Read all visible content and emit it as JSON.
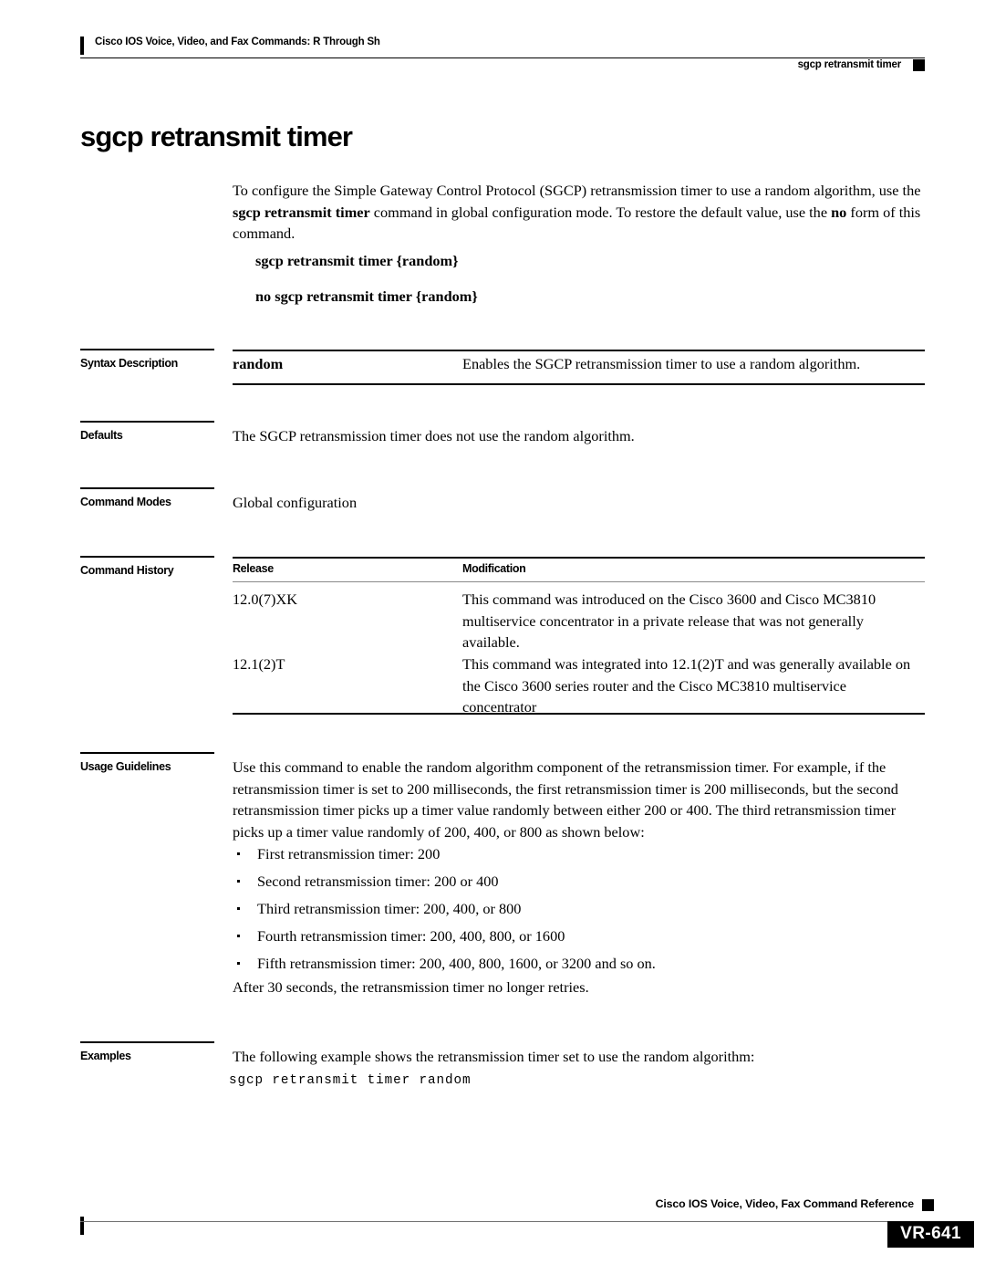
{
  "header": {
    "book_title": "Cisco IOS Voice, Video, and Fax Commands: R Through Sh",
    "running_head": "sgcp retransmit timer"
  },
  "command": {
    "title": "sgcp retransmit timer",
    "intro": {
      "part1": "To configure the Simple Gateway Control Protocol (SGCP) retransmission timer to use a random algorithm, use the ",
      "bold1": "sgcp retransmit timer",
      "part2": " command in global configuration mode. To restore the default value, use the ",
      "bold2": "no",
      "part3": " form of this command."
    },
    "syntax": [
      "sgcp retransmit timer {random}",
      "no sgcp retransmit timer {random}"
    ]
  },
  "sections": {
    "syntax_description": {
      "label": "Syntax Description",
      "term": "random",
      "description": "Enables the SGCP retransmission timer to use a random algorithm."
    },
    "defaults": {
      "label": "Defaults",
      "text": "The SGCP retransmission timer does not use the random algorithm."
    },
    "command_modes": {
      "label": "Command Modes",
      "text": "Global configuration"
    },
    "command_history": {
      "label": "Command History",
      "columns": [
        "Release",
        "Modification"
      ],
      "rows": [
        {
          "release": "12.0(7)XK",
          "modification": "This command was introduced on the Cisco 3600 and Cisco MC3810 multiservice concentrator in a private release that was not generally available."
        },
        {
          "release": "12.1(2)T",
          "modification": "This command was integrated into 12.1(2)T and was generally available on the Cisco 3600 series router and the Cisco MC3810 multiservice concentrator"
        }
      ]
    },
    "usage_guidelines": {
      "label": "Usage Guidelines",
      "paragraph": "Use this command to enable the random algorithm component of the retransmission timer. For example, if the retransmission timer is set to 200 milliseconds, the first retransmission timer is 200 milliseconds, but the second retransmission timer picks up a timer value randomly between either 200 or 400. The third retransmission timer picks up a timer value randomly of 200, 400, or 800 as shown below:",
      "bullets": [
        "First retransmission timer: 200",
        "Second retransmission timer: 200 or 400",
        "Third retransmission timer: 200, 400, or 800",
        "Fourth retransmission timer: 200, 400, 800, or 1600",
        "Fifth retransmission timer: 200, 400, 800, 1600, or 3200 and so on."
      ],
      "closing": "After 30 seconds, the retransmission timer no longer retries."
    },
    "examples": {
      "label": "Examples",
      "text": "The following example shows the retransmission timer set to use the random algorithm:",
      "code": "sgcp retransmit timer random"
    }
  },
  "footer": {
    "title": "Cisco IOS Voice, Video, Fax Command Reference",
    "page_number": "VR-641"
  }
}
